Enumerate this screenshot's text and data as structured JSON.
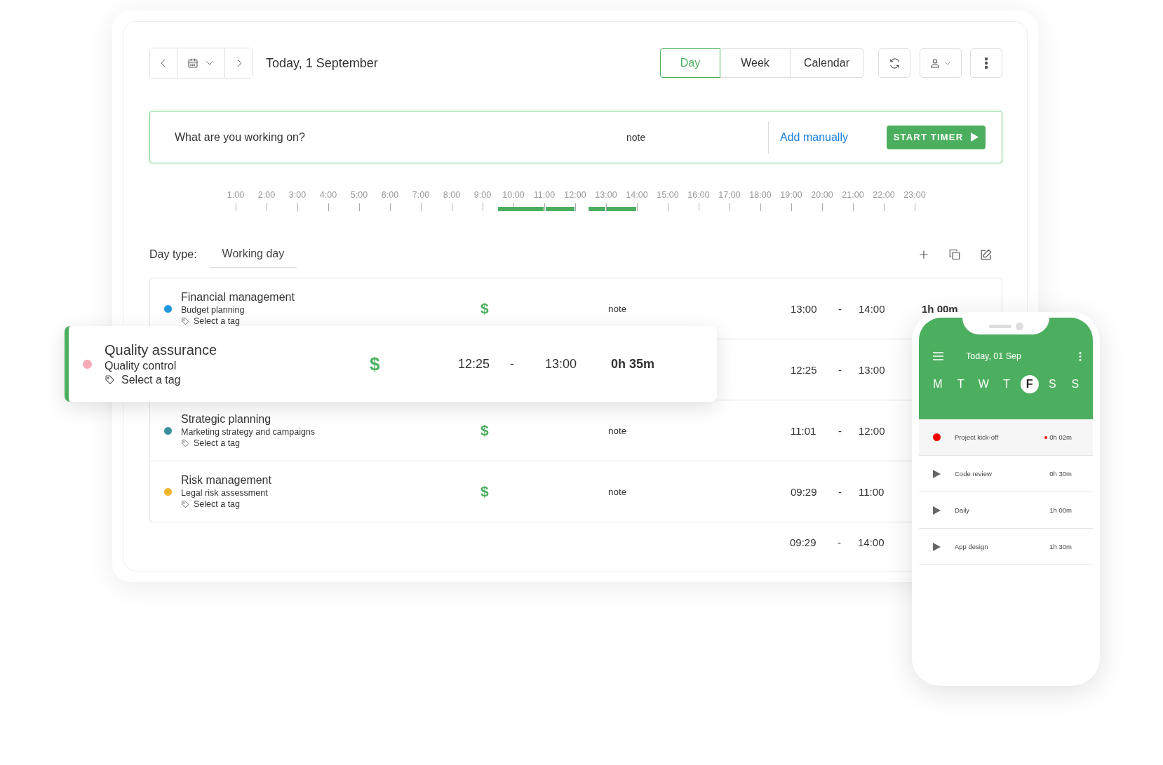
{
  "toolbar": {
    "date": "Today, 1 September",
    "views": [
      {
        "label": "Day",
        "selected": true
      },
      {
        "label": "Week",
        "selected": false
      },
      {
        "label": "Calendar",
        "selected": false
      }
    ]
  },
  "entry_bar": {
    "placeholder": "What are you working on?",
    "note_placeholder": "note",
    "add_manually": "Add manually",
    "start_button": "START TIMER"
  },
  "timeline": {
    "hours": [
      "1:00",
      "2:00",
      "3:00",
      "4:00",
      "5:00",
      "6:00",
      "7:00",
      "8:00",
      "9:00",
      "10:00",
      "11:00",
      "12:00",
      "13:00",
      "14:00",
      "15:00",
      "16:00",
      "17:00",
      "18:00",
      "19:00",
      "20:00",
      "21:00",
      "22:00",
      "23:00"
    ]
  },
  "day_type": {
    "label": "Day type:",
    "value": "Working day"
  },
  "entries": [
    {
      "project": "Financial management",
      "task": "Budget planning",
      "tag": "Select a tag",
      "color": "#2196e0",
      "billable": "$",
      "note": "note",
      "start": "13:00",
      "dash": "-",
      "end": "14:00",
      "duration": "1h 00m"
    },
    {
      "start": "12:25",
      "dash": "-",
      "end": "13:00"
    },
    {
      "project": "Strategic planning",
      "task": "Marketing strategy and campaigns",
      "tag": "Select a tag",
      "color": "#3a8fa0",
      "billable": "$",
      "note": "note",
      "start": "11:01",
      "dash": "-",
      "end": "12:00"
    },
    {
      "project": "Risk management",
      "task": "Legal risk assessment",
      "tag": "Select a tag",
      "color": "#f0b429",
      "billable": "$",
      "note": "note",
      "start": "09:29",
      "dash": "-",
      "end": "11:00"
    }
  ],
  "total": {
    "start": "09:29",
    "dash": "-",
    "end": "14:00"
  },
  "highlighted_entry": {
    "project": "Quality assurance",
    "task": "Quality control",
    "tag": "Select a tag",
    "color": "#f4a9b4",
    "billable": "$",
    "start": "12:25",
    "dash": "-",
    "end": "13:00",
    "duration": "0h 35m"
  },
  "phone": {
    "title": "Today, 01 Sep",
    "weekdays": [
      {
        "label": "M",
        "selected": false
      },
      {
        "label": "T",
        "selected": false
      },
      {
        "label": "W",
        "selected": false
      },
      {
        "label": "T",
        "selected": false
      },
      {
        "label": "F",
        "selected": true
      },
      {
        "label": "S",
        "selected": false
      },
      {
        "label": "S",
        "selected": false
      }
    ],
    "items": [
      {
        "name": "Project kick-off",
        "duration": "0h 02m",
        "running": true
      },
      {
        "name": "Code review",
        "duration": "0h 30m",
        "running": false
      },
      {
        "name": "Daily",
        "duration": "1h 00m",
        "running": false
      },
      {
        "name": "App design",
        "duration": "1h 30m",
        "running": false
      }
    ]
  }
}
